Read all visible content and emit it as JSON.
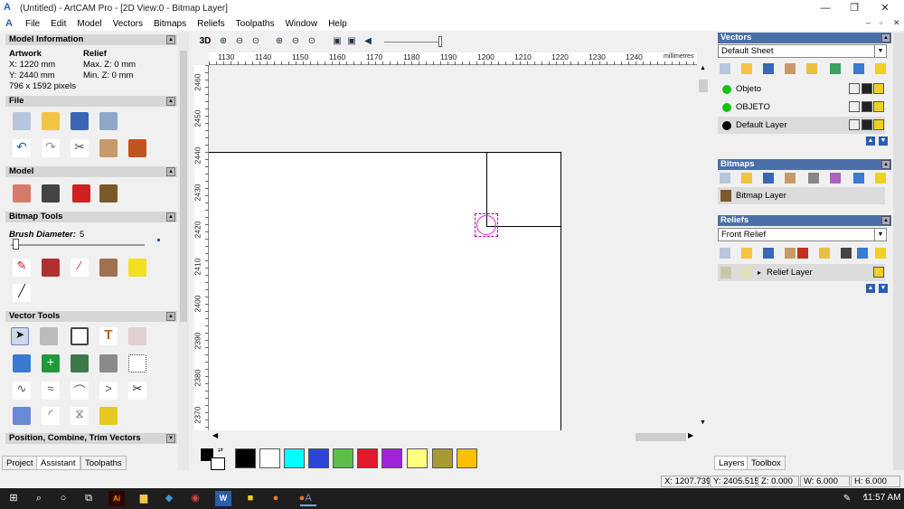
{
  "window": {
    "title": "(Untitled) - ArtCAM Pro - [2D View:0 - Bitmap Layer]",
    "min": "—",
    "restore": "❐",
    "close": "✕"
  },
  "menu": [
    "File",
    "Edit",
    "Model",
    "Vectors",
    "Bitmaps",
    "Reliefs",
    "Toolpaths",
    "Window",
    "Help"
  ],
  "left": {
    "model_info": {
      "title": "Model Information",
      "artwork_h": "Artwork",
      "relief_h": "Relief",
      "x": "X: 1220 mm",
      "y": "Y: 2440 mm",
      "pixels": "796 x 1592 pixels",
      "maxz": "Max. Z: 0 mm",
      "minz": "Min. Z: 0 mm"
    },
    "file_title": "File",
    "model_title": "Model",
    "bitmap_tools": {
      "title": "Bitmap Tools",
      "brush_label": "Brush Diameter:",
      "brush_value": "5"
    },
    "vector_tools_title": "Vector Tools",
    "pct_title": "Position, Combine, Trim Vectors"
  },
  "tabs_left": [
    "Project",
    "Assistant",
    "Toolpaths"
  ],
  "view": {
    "label_3d": "3D",
    "units": "millimetres",
    "hticks": [
      "1130",
      "1140",
      "1150",
      "1160",
      "1170",
      "1180",
      "1190",
      "1200",
      "1210",
      "1220",
      "1230",
      "1240"
    ],
    "vticks": [
      "2460",
      "2450",
      "2440",
      "2430",
      "2420",
      "2410",
      "2400",
      "2390",
      "2380",
      "2370"
    ]
  },
  "palette": [
    "#000000",
    "#ffffff",
    "#00ffff",
    "#2b45d8",
    "#5cbf4a",
    "#e0192b",
    "#a224d8",
    "#ffff80",
    "#a89a33",
    "#ffc000"
  ],
  "right": {
    "vectors": {
      "title": "Vectors",
      "sheet": "Default Sheet",
      "layers": [
        {
          "name": "Objeto",
          "color": "#16c116"
        },
        {
          "name": "OBJETO",
          "color": "#16c116"
        },
        {
          "name": "Default Layer",
          "color": "#000000"
        }
      ]
    },
    "bitmaps": {
      "title": "Bitmaps",
      "layer": "Bitmap Layer"
    },
    "reliefs": {
      "title": "Reliefs",
      "relief": "Front Relief",
      "layer": "Relief Layer"
    }
  },
  "tabs_right": [
    "Layers",
    "Toolbox"
  ],
  "status": {
    "x": "X: 1207.739",
    "y": "Y: 2405.515",
    "z": "Z: 0.000",
    "w": "W: 6.000",
    "h": "H: 6.000"
  },
  "taskbar": {
    "time": "11:57 AM"
  }
}
